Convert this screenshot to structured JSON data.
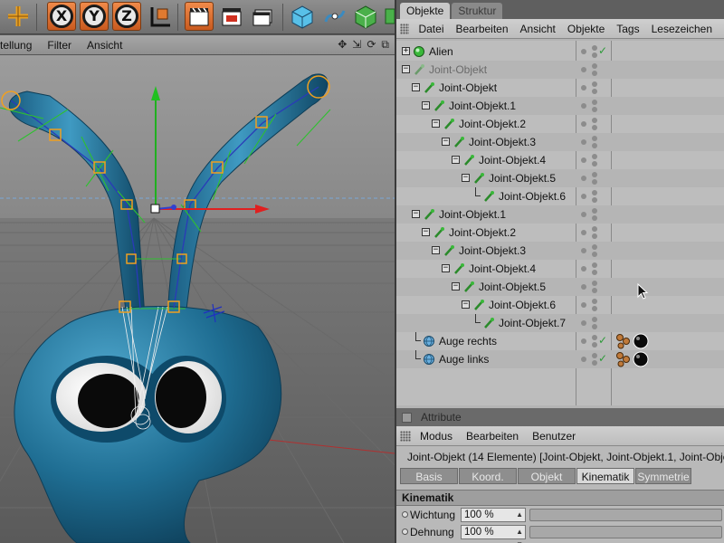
{
  "viewport": {
    "menu": [
      "tellung",
      "Filter",
      "Ansicht"
    ]
  },
  "toolbar": {
    "axis_x": "X",
    "axis_y": "Y",
    "axis_z": "Z"
  },
  "object_manager": {
    "tabs": [
      "Objekte",
      "Struktur"
    ],
    "menu": [
      "Datei",
      "Bearbeiten",
      "Ansicht",
      "Objekte",
      "Tags",
      "Lesezeichen"
    ],
    "rows": [
      {
        "label": "Alien",
        "depth": 0,
        "icon": "null-object-icon",
        "expander": "+",
        "check": true,
        "dim": false
      },
      {
        "label": "Joint-Objekt",
        "depth": 0,
        "icon": "joint-icon",
        "expander": "-",
        "check": false,
        "dim": true
      },
      {
        "label": "Joint-Objekt",
        "depth": 1,
        "icon": "joint-icon",
        "expander": "-",
        "check": false,
        "dim": false
      },
      {
        "label": "Joint-Objekt.1",
        "depth": 2,
        "icon": "joint-icon",
        "expander": "-",
        "check": false,
        "dim": false
      },
      {
        "label": "Joint-Objekt.2",
        "depth": 3,
        "icon": "joint-icon",
        "expander": "-",
        "check": false,
        "dim": false
      },
      {
        "label": "Joint-Objekt.3",
        "depth": 4,
        "icon": "joint-icon",
        "expander": "-",
        "check": false,
        "dim": false
      },
      {
        "label": "Joint-Objekt.4",
        "depth": 5,
        "icon": "joint-icon",
        "expander": "-",
        "check": false,
        "dim": false
      },
      {
        "label": "Joint-Objekt.5",
        "depth": 6,
        "icon": "joint-icon",
        "expander": "-",
        "check": false,
        "dim": false
      },
      {
        "label": "Joint-Objekt.6",
        "depth": 7,
        "icon": "joint-icon",
        "expander": "",
        "check": false,
        "dim": false
      },
      {
        "label": "Joint-Objekt.1",
        "depth": 1,
        "icon": "joint-icon",
        "expander": "-",
        "check": false,
        "dim": false
      },
      {
        "label": "Joint-Objekt.2",
        "depth": 2,
        "icon": "joint-icon",
        "expander": "-",
        "check": false,
        "dim": false
      },
      {
        "label": "Joint-Objekt.3",
        "depth": 3,
        "icon": "joint-icon",
        "expander": "-",
        "check": false,
        "dim": false
      },
      {
        "label": "Joint-Objekt.4",
        "depth": 4,
        "icon": "joint-icon",
        "expander": "-",
        "check": false,
        "dim": false
      },
      {
        "label": "Joint-Objekt.5",
        "depth": 5,
        "icon": "joint-icon",
        "expander": "-",
        "check": false,
        "dim": false
      },
      {
        "label": "Joint-Objekt.6",
        "depth": 6,
        "icon": "joint-icon",
        "expander": "-",
        "check": false,
        "dim": false
      },
      {
        "label": "Joint-Objekt.7",
        "depth": 7,
        "icon": "joint-icon",
        "expander": "",
        "check": false,
        "dim": false
      },
      {
        "label": "Auge rechts",
        "depth": 1,
        "icon": "sphere-icon",
        "expander": "",
        "check": true,
        "dim": false,
        "tags": true
      },
      {
        "label": "Auge links",
        "depth": 1,
        "icon": "sphere-icon",
        "expander": "",
        "check": true,
        "dim": false,
        "tags": true
      }
    ]
  },
  "attributes": {
    "title": "Attribute",
    "menu": [
      "Modus",
      "Bearbeiten",
      "Benutzer"
    ],
    "info": "Joint-Objekt (14 Elemente) [Joint-Objekt, Joint-Objekt.1, Joint-Obje",
    "tabs": [
      "Basis",
      "Koord.",
      "Objekt",
      "Kinematik",
      "Symmetrie"
    ],
    "active_tab": "Kinematik",
    "section": "Kinematik",
    "params": [
      {
        "label": "Wichtung",
        "value": "100 %"
      },
      {
        "label": "Dehnung",
        "value": "100 %"
      }
    ]
  },
  "colors": {
    "accent_orange": "#e0702c",
    "alien_body": "#2f7fa6",
    "joint_orange": "#f0a020",
    "bone_green": "#2fc030",
    "axis_red": "#e02020",
    "axis_green": "#20c020",
    "check_green": "#2e9a3a"
  }
}
